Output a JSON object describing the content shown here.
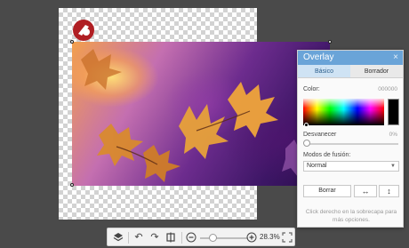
{
  "overlay_panel": {
    "title": "Overlay",
    "close_symbol": "×",
    "tabs": [
      {
        "label": "Básico",
        "active": true
      },
      {
        "label": "Borrador",
        "active": false
      }
    ],
    "color_label": "Color:",
    "color_value": "000000",
    "fade_label": "Desvanecer",
    "fade_value": "0%",
    "fade_level": 0,
    "blend_label": "Modos de fusión:",
    "blend_selected": "Normal",
    "erase_button": "Borrar",
    "flip_h_icon": "flip-horizontal-icon",
    "flip_v_icon": "flip-vertical-icon",
    "hint": "Click derecho en la sobrecapa para más opciones.",
    "accent_color": "#6aa4d8"
  },
  "toolbar": {
    "icons": [
      "layers-icon",
      "undo-icon",
      "redo-icon",
      "compare-icon",
      "zoom-out-icon",
      "zoom-in-icon",
      "fullscreen-icon"
    ],
    "zoom_text": "28.3%",
    "zoom_level": 0.283
  },
  "canvas": {
    "background": "transparent-checkerboard",
    "logo_icon": "brand-logo-icon"
  }
}
